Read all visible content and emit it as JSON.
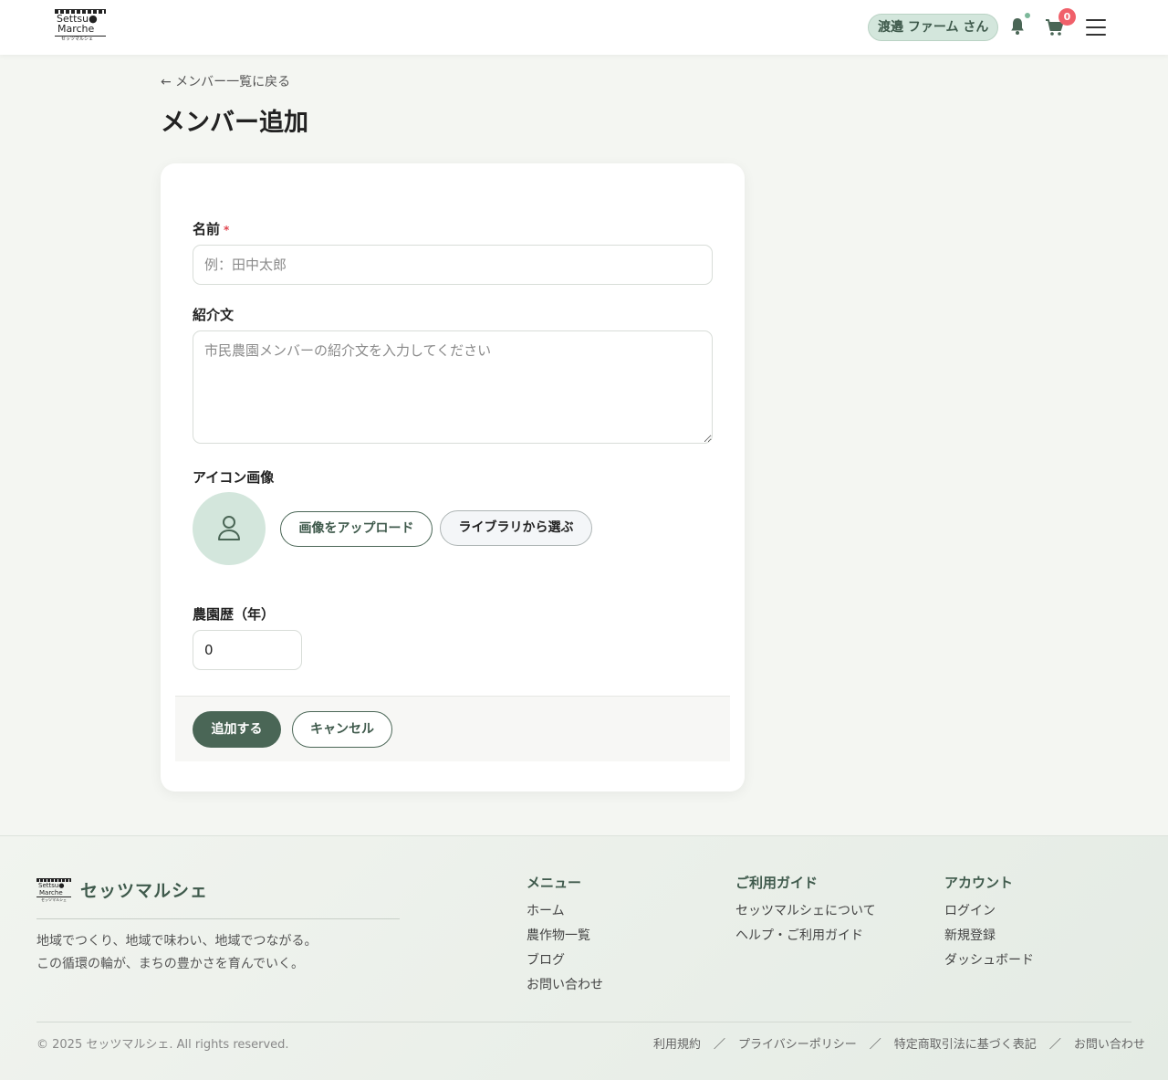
{
  "header": {
    "logo": {
      "line1": "Settsu●",
      "line2": "Marche",
      "line3": "セッツマルシェ"
    },
    "user_badge": "渡邉 ファーム さん",
    "notification_dot_color": "#7cb89a",
    "cart_count": "0",
    "icons": [
      "bell-icon",
      "cart-icon",
      "hamburger-menu-icon"
    ]
  },
  "main": {
    "back_link": "← メンバー一覧に戻る",
    "title": "メンバー追加",
    "form": {
      "name_label": "名前",
      "required_mark": "*",
      "name_value": "",
      "name_placeholder": "例：田中太郎",
      "intro_label": "紹介文",
      "intro_value": "",
      "intro_placeholder": "市民農園メンバーの紹介文を入力してください",
      "icon_label": "アイコン画像",
      "upload_button": "画像をアップロード",
      "library_button": "ライブラリから選ぶ",
      "years_label": "農園歴（年）",
      "years_value": "0",
      "submit_button": "追加する",
      "cancel_button": "キャンセル"
    }
  },
  "footer": {
    "logo": {
      "line1": "Settsu●",
      "line2": "Marche",
      "line3": "セッツマルシェ"
    },
    "brand": "セッツマルシェ",
    "tagline": [
      "地域でつくり、地域で味わい、地域でつながる。",
      "この循環の輪が、まちの豊かさを育んでいく。"
    ],
    "columns": [
      {
        "heading": "メニュー",
        "links": [
          "ホーム",
          "農作物一覧",
          "ブログ",
          "お問い合わせ"
        ]
      },
      {
        "heading": "ご利用ガイド",
        "links": [
          "セッツマルシェについて",
          "ヘルプ・ご利用ガイド"
        ]
      },
      {
        "heading": "アカウント",
        "links": [
          "ログイン",
          "新規登録",
          "ダッシュボード"
        ]
      }
    ],
    "copyright": "© 2025 セッツマルシェ. All rights reserved.",
    "legal_links": [
      "利用規約",
      "プライバシーポリシー",
      "特定商取引法に基づく表記",
      "お問い合わせ"
    ],
    "legal_separator": "／"
  },
  "colors": {
    "primary": "#4a6656",
    "primary_light": "#d3e6dc",
    "badge_red": "#f0606a",
    "page_bg": "#f4f6f2"
  }
}
